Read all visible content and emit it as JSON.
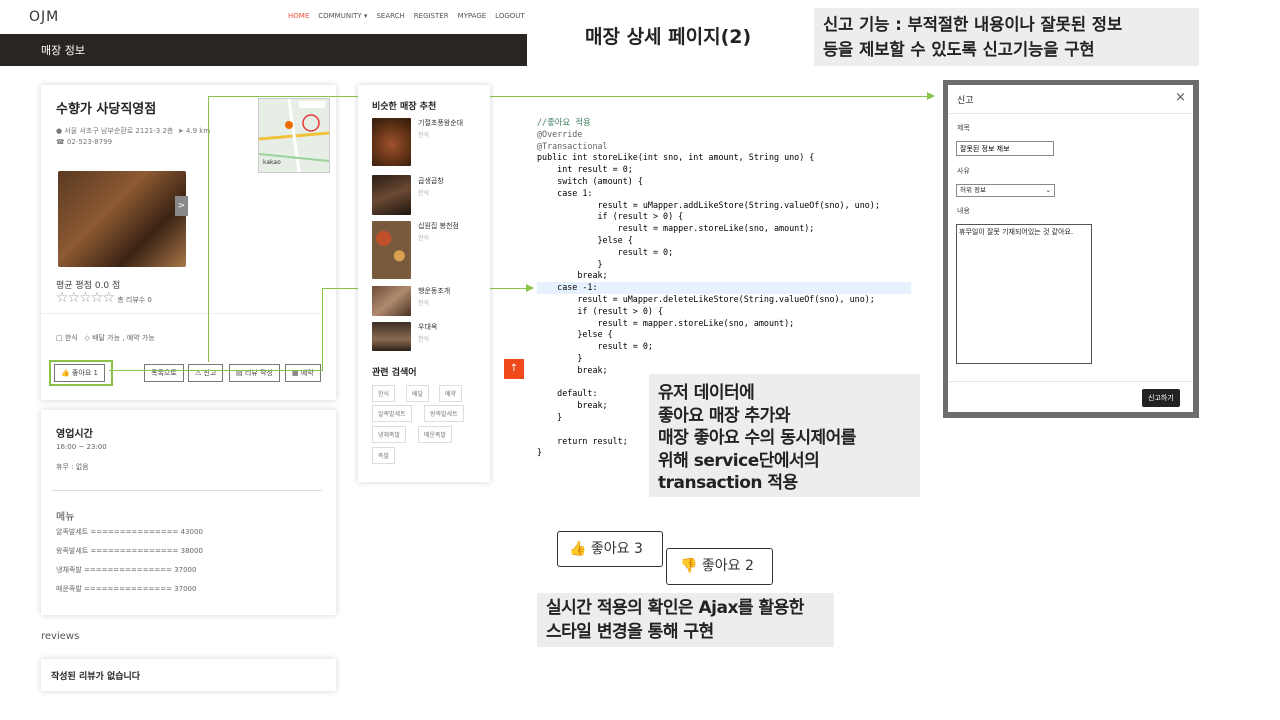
{
  "header": {
    "logo": "OJM",
    "nav": [
      "HOME",
      "COMMUNITY ▾",
      "SEARCH",
      "REGISTER",
      "MYPAGE",
      "LOGOUT"
    ],
    "banner": "매장 정보"
  },
  "slide": {
    "title": "매장 상세 페이지(2)",
    "report_note_line1": "신고 기능 : 부적절한 내용이나 잘못된 정보",
    "report_note_line2": "등을 제보할 수 있도록 신고기능을  구현",
    "tx_note": [
      "유저 데이터에",
      "좋아요 매장 추가와",
      "매장 좋아요 수의 동시제어를",
      "위해 service단에서의",
      "transaction 적용"
    ],
    "ajax_note": [
      "실시간 적용의 확인은 Ajax를 활용한",
      "스타일 변경을 통해 구현"
    ],
    "like_on": "좋아요 3",
    "like_off": "좋아요 2"
  },
  "store": {
    "name": "수향가 사당직영점",
    "address": "서울 서초구 남부순환로 2121-3 2층",
    "distance": "4.9 km",
    "phone": "02-523-8799",
    "map_badge": "kakao",
    "rating": "평균 평점 0.0 점",
    "review_count": "총 리뷰수 0",
    "category": "한식",
    "services": "배달 가능 , 예약 가능",
    "buttons": {
      "like": "좋아요 1",
      "list": "목록으로",
      "report": "신고",
      "review": "리뷰 작성",
      "reserve": "예약"
    },
    "hours_title": "영업시간",
    "hours": "16:00 ~ 23:00",
    "holiday": "휴무 : 없음",
    "menu_title": "메뉴",
    "menu": [
      "알족발세트 =============== 43000",
      "왕족발세트 =============== 38000",
      "냉채족발 =============== 37000",
      "매운족발 =============== 37000"
    ],
    "reviews_title": "reviews",
    "no_reviews": "작성된 리뷰가 없습니다"
  },
  "similar": {
    "title": "비슷한 매장 추천",
    "items": [
      {
        "name": "기절초풍왕순대",
        "cat": "한식"
      },
      {
        "name": "곱생곱창",
        "cat": "한식"
      },
      {
        "name": "십원집 봉천점",
        "cat": "한식"
      },
      {
        "name": "행운동조개",
        "cat": "한식"
      },
      {
        "name": "우대옥",
        "cat": "한식"
      }
    ],
    "related_title": "관련 검색어",
    "tags": [
      "한식",
      "배달",
      "예약",
      "알족발세트",
      "왕족발세트",
      "냉채족발",
      "매운족발",
      "족발"
    ]
  },
  "code_lines": [
    "//좋아요 적용",
    "@Override",
    "@Transactional",
    "public int storeLike(int sno, int amount, String uno) {",
    "    int result = 0;",
    "    switch (amount) {",
    "    case 1:",
    "            result = uMapper.addLikeStore(String.valueOf(sno), uno);",
    "            if (result > 0) {",
    "                result = mapper.storeLike(sno, amount);",
    "            }else {",
    "                result = 0;",
    "            }",
    "        break;",
    "    case -1:",
    "        result = uMapper.deleteLikeStore(String.valueOf(sno), uno);",
    "        if (result > 0) {",
    "            result = mapper.storeLike(sno, amount);",
    "        }else {",
    "            result = 0;",
    "        }",
    "        break;",
    "",
    "    default:",
    "        break;",
    "    }",
    "",
    "    return result;",
    "}"
  ],
  "modal": {
    "title": "신고",
    "label_title": "제목",
    "title_value": "잘못된 정보 제보",
    "label_reason": "사유",
    "reason_value": "허위 정보",
    "label_content": "내용",
    "content_value": "휴무일이 잘못 기재되어있는 것 같아요.",
    "submit": "신고하기"
  },
  "colors": {
    "banner": "#2b2522",
    "accent": "#e8553e",
    "highlight_green": "#8bc34a",
    "top_button": "#f04a1c"
  }
}
